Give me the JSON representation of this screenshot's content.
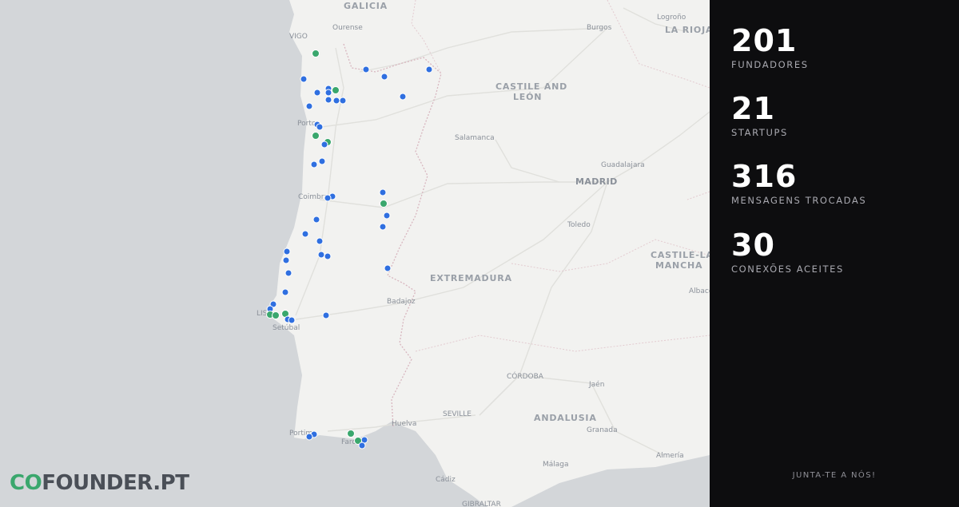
{
  "map": {
    "labels": {
      "galicia": "GALICIA",
      "castile_leon_1": "CASTILE AND",
      "castile_leon_2": "LEÓN",
      "la_rioja": "LA RIOJA",
      "extremadura": "EXTREMADURA",
      "castile_mancha_1": "CASTILE-LA",
      "castile_mancha_2": "MANCHA",
      "andalusia": "ANDALUSIA",
      "vigo": "VIGO",
      "ourense": "Ourense",
      "burgos": "Burgos",
      "logrono": "Logroño",
      "porto": "Porto",
      "salamanca": "Salamanca",
      "guadalajara": "Guadalajara",
      "madrid": "MADRID",
      "coimbra": "Coimbra",
      "toledo": "Toledo",
      "albacete": "Albace",
      "lisboa": "LIS",
      "setubal": "Setúbal",
      "badajoz": "Badajoz",
      "cordoba": "CÓRDOBA",
      "jaen": "Jaén",
      "seville": "SEVILLE",
      "huelva": "Huelva",
      "granada": "Granada",
      "portimao": "Portim",
      "faro": "Faro",
      "malaga": "Málaga",
      "almeria": "Almería",
      "cadiz": "Cádiz",
      "gibraltar": "GIBRALTAR"
    },
    "legend_colors": {
      "founder": "#2f6fe0",
      "startup": "#3aa76d"
    }
  },
  "logo": {
    "part1": "CO",
    "part2": "FOUNDER.PT"
  },
  "stats": [
    {
      "value": "201",
      "label": "FUNDADORES"
    },
    {
      "value": "21",
      "label": "STARTUPS"
    },
    {
      "value": "316",
      "label": "MENSAGENS TROCADAS"
    },
    {
      "value": "30",
      "label": "CONEXÕES ACEITES"
    }
  ],
  "cta": "JUNTA-TE A NÓS!"
}
